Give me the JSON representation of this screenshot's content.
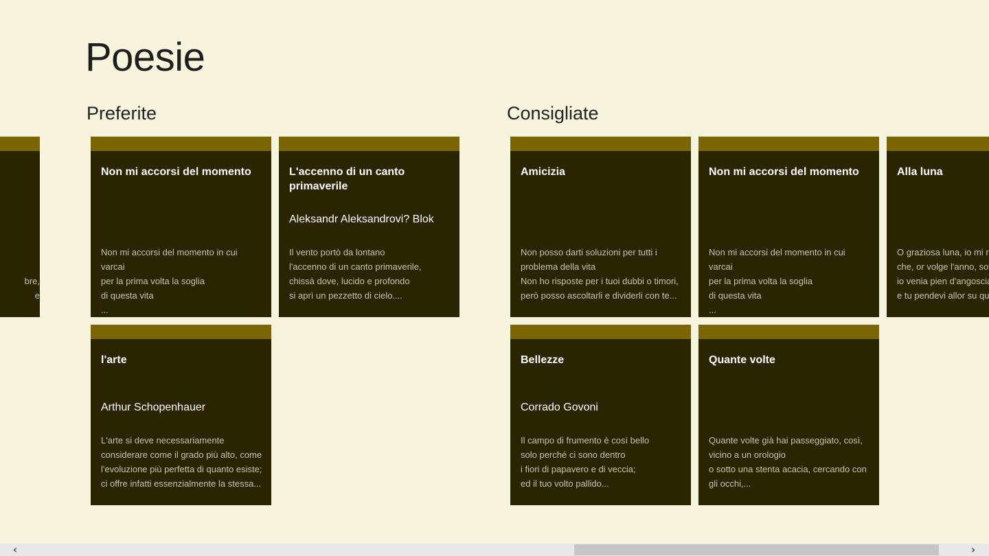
{
  "page": {
    "title": "Poesie"
  },
  "groups": {
    "preferite": {
      "header": "Preferite"
    },
    "consigliate": {
      "header": "Consigliate"
    }
  },
  "tiles": {
    "left_partial": {
      "title": "",
      "excerpt": "\n\nbre,\ne"
    },
    "p1": {
      "title": "Non mi accorsi del momento",
      "author": "",
      "excerpt": "Non mi accorsi del momento in cui varcai\nper la prima volta la soglia\ndi questa vita\n..."
    },
    "p2": {
      "title": "L'accenno di un canto primaverile",
      "author": "Aleksandr Aleksandrovi? Blok",
      "excerpt": "Il vento portò da lontano\nl'accenno di un canto primaverile,\nchissà dove, lucido e profondo\nsi aprì un pezzetto di cielo...."
    },
    "p3": {
      "title": "l'arte",
      "author": "Arthur Schopenhauer",
      "excerpt": "L'arte si deve necessariamente\nconsiderare come il grado più alto, come\nl'evoluzione più perfetta di quanto esiste;\nci offre infatti essenzialmente la stessa..."
    },
    "c1": {
      "title": "Amicizia",
      "author": "",
      "excerpt": "Non posso darti soluzioni per tutti i\nproblema della vita\nNon ho risposte per i tuoi dubbi o timori,\nperò posso ascoltarli e dividerli con te..."
    },
    "c2": {
      "title": "Non mi accorsi del momento",
      "author": "",
      "excerpt": "Non mi accorsi del momento in cui varcai\nper la prima volta la soglia\ndi questa vita\n..."
    },
    "c3": {
      "title": "Alla luna",
      "author": "",
      "excerpt": "O graziosa luna, io mi ra\nche, or volge l'anno, sov\nio venia pien d'angoscia\ne tu pendevi allor su que"
    },
    "c4": {
      "title": "Bellezze",
      "author": "Corrado Govoni",
      "excerpt": "Il campo di frumento è così bello\nsolo perché ci sono dentro\ni fiori di papavero e di veccia;\ned il tuo volto pallido..."
    },
    "c5": {
      "title": "Quante volte",
      "author": "",
      "excerpt": "Quante volte già hai passeggiato, così,\nvicino a un orologio\no sotto una stenta acacia, cercando con\ngli occhi,..."
    }
  },
  "scrollbar": {
    "left_arrow": "‹",
    "right_arrow": "›",
    "position_fraction": 0.58
  },
  "colors": {
    "background": "#f5f4dc",
    "tile": "#2a2400",
    "tile_accent": "#7a6500"
  }
}
